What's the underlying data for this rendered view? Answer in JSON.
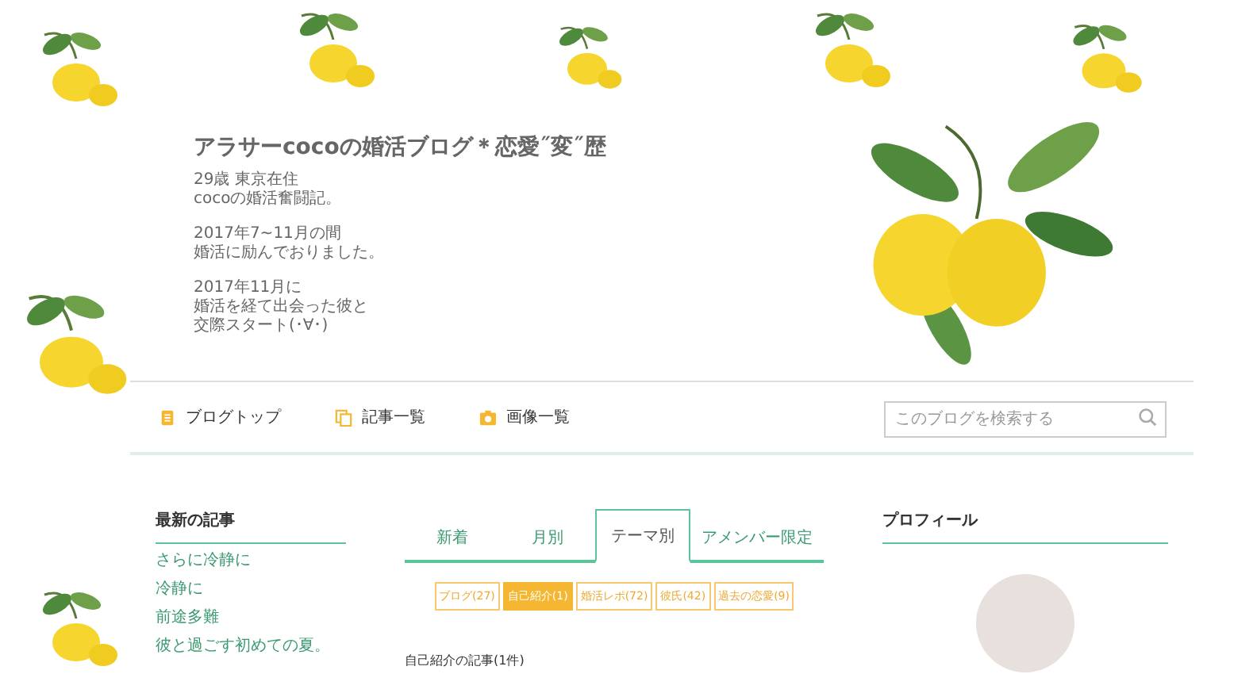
{
  "header": {
    "title": "アラサーcocoの婚活ブログ＊恋愛˝変˝歴",
    "description": [
      [
        "29歳 東京在住",
        "cocoの婚活奮闘記。"
      ],
      [
        "2017年7~11月の間",
        "婚活に励んでおりました。"
      ],
      [
        "2017年11月に",
        "婚活を経て出会った彼と",
        "交際スタート(･∀･)"
      ]
    ]
  },
  "nav": {
    "links": [
      {
        "label": "ブログトップ",
        "kind": "top"
      },
      {
        "label": "記事一覧",
        "kind": "list"
      },
      {
        "label": "画像一覧",
        "kind": "image"
      }
    ],
    "search": {
      "placeholder": "このブログを検索する"
    }
  },
  "latest": {
    "heading": "最新の記事",
    "items": [
      "さらに冷静に",
      "冷静に",
      "前途多難",
      "彼と過ごす初めての夏。"
    ]
  },
  "tabs": [
    {
      "label": "新着",
      "selected": false
    },
    {
      "label": "月別",
      "selected": false
    },
    {
      "label": "テーマ別",
      "selected": true
    },
    {
      "label": "アメンバー限定",
      "selected": false
    }
  ],
  "themes": [
    {
      "label": "ブログ(27)",
      "selected": false
    },
    {
      "label": "自己紹介(1)",
      "selected": true
    },
    {
      "label": "婚活レポ(72)",
      "selected": false
    },
    {
      "label": "彼氏(42)",
      "selected": false
    },
    {
      "label": "過去の恋愛(9)",
      "selected": false
    }
  ],
  "section_heading": "自己紹介の記事(1件)",
  "profile": {
    "heading": "プロフィール"
  }
}
